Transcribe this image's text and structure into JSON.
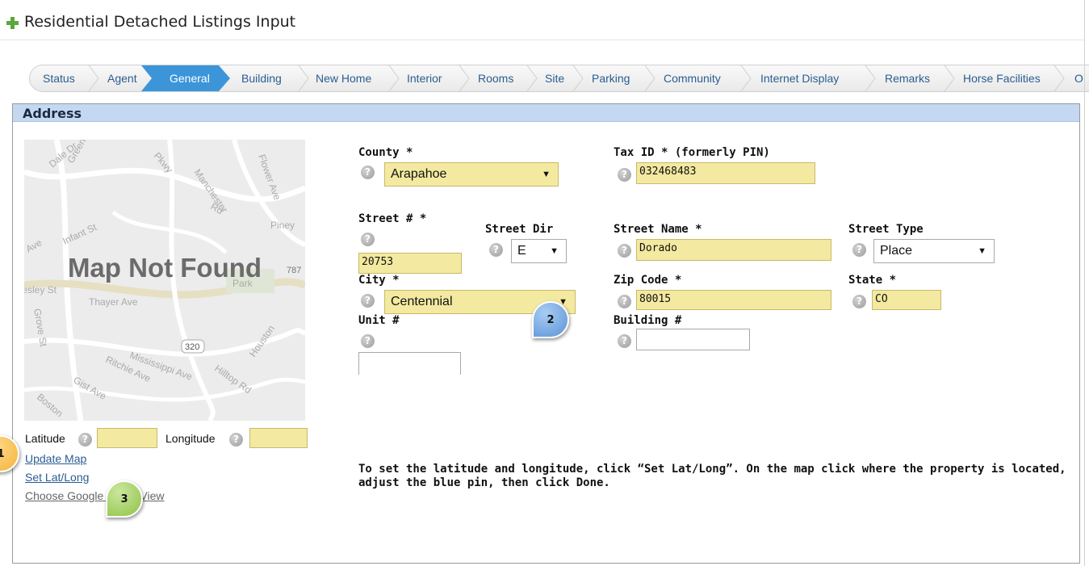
{
  "header": {
    "title": "Residential Detached Listings Input",
    "icon": "plus-icon"
  },
  "tabs": [
    {
      "label": "Status",
      "active": false
    },
    {
      "label": "Agent",
      "active": false
    },
    {
      "label": "General",
      "active": true
    },
    {
      "label": "Building",
      "active": false
    },
    {
      "label": "New Home",
      "active": false
    },
    {
      "label": "Interior",
      "active": false
    },
    {
      "label": "Rooms",
      "active": false
    },
    {
      "label": "Site",
      "active": false
    },
    {
      "label": "Parking",
      "active": false
    },
    {
      "label": "Community",
      "active": false
    },
    {
      "label": "Internet Display",
      "active": false
    },
    {
      "label": "Remarks",
      "active": false
    },
    {
      "label": "Horse Facilities",
      "active": false
    },
    {
      "label": "O",
      "active": false
    }
  ],
  "section": {
    "title": "Address"
  },
  "map": {
    "message": "Map Not Found",
    "streets": [
      "Dale Dr",
      "Greenbriar",
      "Pkwy",
      "Manchester",
      "Rd",
      "Flower Ave",
      "Piney",
      "Infant St",
      "Ave",
      "Park",
      "787",
      "Ivesley St",
      "Thayer Ave",
      "Grove St",
      "320",
      "Mississippi Ave",
      "Ritchie Ave",
      "Hilltop Rd",
      "Houston",
      "Gist Ave",
      "Boston"
    ]
  },
  "form": {
    "county": {
      "label": "County *",
      "value": "Arapahoe"
    },
    "tax_id": {
      "label": "Tax ID * (formerly PIN)",
      "value": "032468483"
    },
    "street_num": {
      "label": "Street # *",
      "value": "20753"
    },
    "street_dir": {
      "label": "Street Dir",
      "value": "E"
    },
    "street_name": {
      "label": "Street Name *",
      "value": "Dorado"
    },
    "street_type": {
      "label": "Street Type",
      "value": "Place"
    },
    "city": {
      "label": "City *",
      "value": "Centennial"
    },
    "zip": {
      "label": "Zip Code *",
      "value": "80015"
    },
    "state": {
      "label": "State *",
      "value": "CO"
    },
    "unit": {
      "label": "Unit #",
      "value": ""
    },
    "building": {
      "label": "Building #",
      "value": ""
    }
  },
  "latlong": {
    "lat_label": "Latitude",
    "lat_value": "",
    "long_label": "Longitude",
    "long_value": ""
  },
  "links": {
    "update_map": "Update Map",
    "set_latlong": "Set Lat/Long",
    "street_view": "Choose Google Street View"
  },
  "instructions": "To set the latitude and longitude, click “Set Lat/Long”. On the map click where the property is located, adjust the blue pin, then click Done.",
  "callouts": [
    {
      "number": "1",
      "color": "#f4b43a"
    },
    {
      "number": "2",
      "color": "#5b93d6"
    },
    {
      "number": "3",
      "color": "#8fc245"
    }
  ],
  "help_glyph": "?",
  "caret_glyph": "▼",
  "colors": {
    "accent": "#3c95d9",
    "link": "#2a5d91",
    "required_field": "#f3e9a0",
    "section_header": "#c4d8f2"
  }
}
